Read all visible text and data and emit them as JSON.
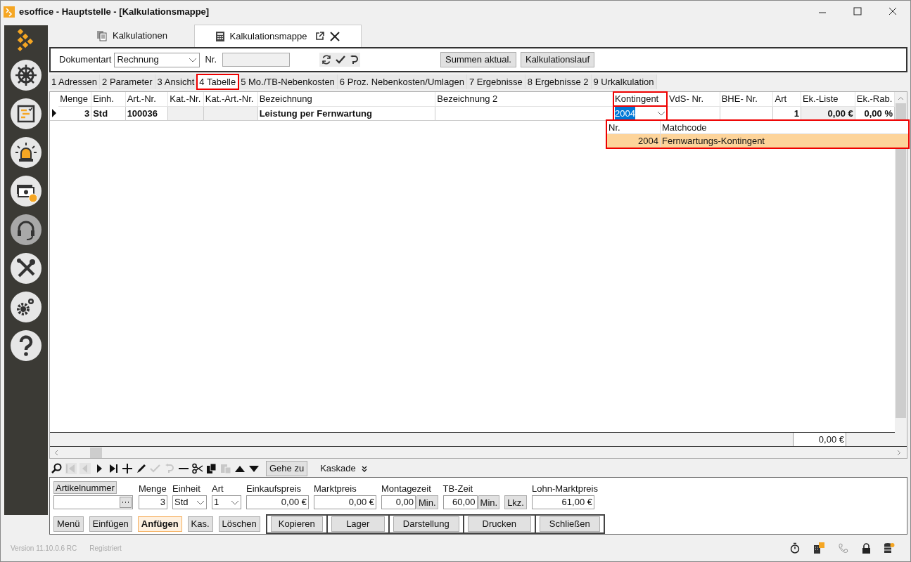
{
  "window": {
    "title": "esoffice - Hauptstelle - [Kalkulationsmappe]"
  },
  "doc_tabs": [
    {
      "label": "Kalkulationen",
      "selected": false
    },
    {
      "label": "Kalkulationsmappe",
      "selected": true
    }
  ],
  "toolbar": {
    "doc_type_label": "Dokumentart",
    "doc_type": "Rechnung",
    "nr_label": "Nr.",
    "buttons": [
      "Summen aktual.",
      "Kalkulationslauf"
    ]
  },
  "tabs": [
    {
      "label": "1 Adressen",
      "selected": false,
      "highlighted": false
    },
    {
      "label": "2 Parameter",
      "selected": false,
      "highlighted": false
    },
    {
      "label": "3 Ansicht",
      "selected": false,
      "highlighted": false
    },
    {
      "label": "4 Tabelle",
      "selected": true,
      "highlighted": true
    },
    {
      "label": "5 Mo./TB-Nebenkosten",
      "selected": false,
      "highlighted": false
    },
    {
      "label": "6 Proz. Nebenkosten/Umlagen",
      "selected": false,
      "highlighted": false
    },
    {
      "label": "7 Ergebnisse",
      "selected": false,
      "highlighted": false
    },
    {
      "label": "8 Ergebnisse 2",
      "selected": false,
      "highlighted": false
    },
    {
      "label": "9 Urkalkulation",
      "selected": false,
      "highlighted": false
    }
  ],
  "table": {
    "columns": [
      {
        "label": "Menge",
        "kind": "number",
        "readonly": false,
        "highlighted": false
      },
      {
        "label": "Einh.",
        "kind": "text",
        "readonly": false,
        "highlighted": false
      },
      {
        "label": "Art.-Nr.",
        "kind": "text",
        "readonly": false,
        "highlighted": false
      },
      {
        "label": "Kat.-Nr.",
        "kind": "text",
        "readonly": true,
        "highlighted": false
      },
      {
        "label": "Kat.-Art.-Nr.",
        "kind": "text",
        "readonly": true,
        "highlighted": false
      },
      {
        "label": "Bezeichnung",
        "kind": "text",
        "readonly": false,
        "highlighted": false
      },
      {
        "label": "Bezeichnung 2",
        "kind": "text",
        "readonly": false,
        "highlighted": false
      },
      {
        "label": "Kontingent",
        "kind": "combo",
        "readonly": false,
        "highlighted": true
      },
      {
        "label": "VdS- Nr.",
        "kind": "text",
        "readonly": false,
        "highlighted": false
      },
      {
        "label": "BHE- Nr.",
        "kind": "text",
        "readonly": false,
        "highlighted": false
      },
      {
        "label": "Art",
        "kind": "number",
        "readonly": false,
        "highlighted": false
      },
      {
        "label": "Ek.-Liste",
        "kind": "number",
        "readonly": true,
        "highlighted": false
      },
      {
        "label": "Ek.-Rab.",
        "kind": "number",
        "readonly": false,
        "highlighted": false
      }
    ],
    "rows": [
      {
        "current": true,
        "cells": [
          "3",
          "Std",
          "100036",
          "",
          "",
          "Leistung per Fernwartung",
          "",
          "2004",
          "",
          "",
          "1",
          "0,00 €",
          "0,00 %"
        ]
      }
    ],
    "total": "0,00 €"
  },
  "dropdown": {
    "highlighted": true,
    "columns": [
      "Nr.",
      "Matchcode"
    ],
    "rows": [
      {
        "selected": true,
        "cells": [
          "2004",
          "Fernwartungs-Kontingent"
        ]
      }
    ]
  },
  "nav_toolbar": {
    "tools": [
      {
        "kind": "search",
        "disabled": false
      },
      {
        "kind": "first",
        "disabled": true
      },
      {
        "kind": "prev",
        "disabled": true
      },
      {
        "kind": "next",
        "disabled": false
      },
      {
        "kind": "last",
        "disabled": false
      },
      {
        "kind": "add",
        "disabled": false
      },
      {
        "kind": "edit",
        "disabled": false
      },
      {
        "kind": "confirm",
        "disabled": true
      },
      {
        "kind": "undo",
        "disabled": true
      },
      {
        "kind": "remove",
        "disabled": false
      },
      {
        "kind": "cut",
        "disabled": false
      },
      {
        "kind": "copy",
        "disabled": false
      },
      {
        "kind": "paste",
        "disabled": true
      },
      {
        "kind": "up",
        "disabled": false
      },
      {
        "kind": "down",
        "disabled": false
      }
    ],
    "goto": "Gehe zu",
    "cascade": "Kaskade"
  },
  "form": {
    "article_button": "Artikelnummer",
    "fields": [
      {
        "kind": "text",
        "label": "Menge",
        "value": "3"
      },
      {
        "kind": "combo",
        "label": "Einheit",
        "value": "Std"
      },
      {
        "kind": "combo",
        "label": "Art",
        "value": "1"
      },
      {
        "kind": "text",
        "label": "Einkaufspreis",
        "value": "0,00 €"
      },
      {
        "kind": "text",
        "label": "Marktpreis",
        "value": "0,00 €"
      },
      {
        "kind": "unit",
        "label": "Montagezeit",
        "value": "0,00",
        "unit": "Min."
      },
      {
        "kind": "unit",
        "label": "TB-Zeit",
        "value": "60,00",
        "unit": "Min."
      },
      {
        "kind": "button",
        "value": "Lkz."
      },
      {
        "kind": "text",
        "label": "Lohn-Marktpreis",
        "value": "61,00 €"
      }
    ],
    "buttons": [
      {
        "label": "Menü",
        "default": false
      },
      {
        "label": "Einfügen",
        "default": false
      },
      {
        "label": "Anfügen",
        "default": true
      },
      {
        "label": "Kas.",
        "default": false
      },
      {
        "label": "Löschen",
        "default": false
      }
    ],
    "group_buttons": [
      "Kopieren",
      "Lager",
      "Darstellung",
      "Drucken",
      "Schließen"
    ]
  },
  "status_bar": {
    "version": "Version 11.10.0.6 RC",
    "license": "Registriert"
  }
}
